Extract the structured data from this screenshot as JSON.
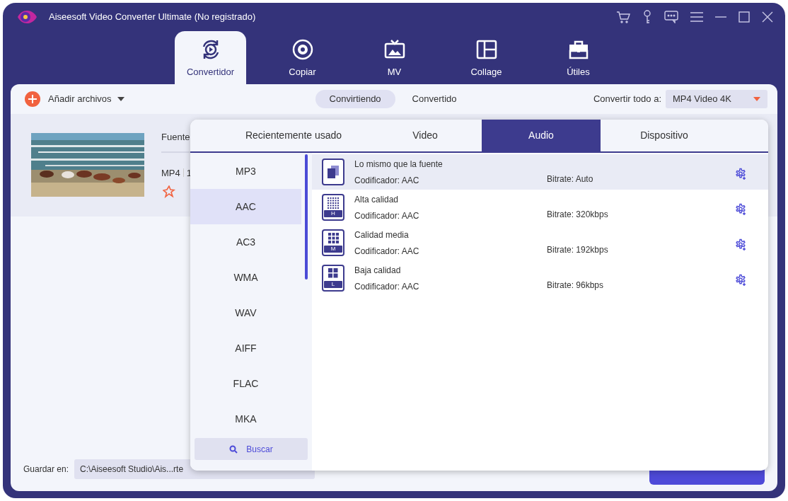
{
  "window": {
    "title": "Aiseesoft Video Converter Ultimate (No registrado)"
  },
  "nav_tabs": [
    {
      "label": "Convertidor",
      "selected": true,
      "kind": "convert"
    },
    {
      "label": "Copiar",
      "selected": false,
      "kind": "disc"
    },
    {
      "label": "MV",
      "selected": false,
      "kind": "tv"
    },
    {
      "label": "Collage",
      "selected": false,
      "kind": "collage"
    },
    {
      "label": "Útiles",
      "selected": false,
      "kind": "toolbox"
    }
  ],
  "toolbar": {
    "add_files": "Añadir archivos",
    "status_tabs": [
      {
        "label": "Convirtiendo",
        "selected": true
      },
      {
        "label": "Convertido",
        "selected": false
      }
    ],
    "convert_all_label": "Convertir todo a:",
    "convert_all_value": "MP4 Video 4K"
  },
  "file": {
    "source_label": "Fuente",
    "format": "MP4",
    "size": "1"
  },
  "popup": {
    "tabs": [
      {
        "label": "Recientemente usado",
        "selected": false
      },
      {
        "label": "Video",
        "selected": false
      },
      {
        "label": "Audio",
        "selected": true
      },
      {
        "label": "Dispositivo",
        "selected": false
      }
    ],
    "formats": [
      {
        "label": "MP3",
        "selected": false
      },
      {
        "label": "AAC",
        "selected": true
      },
      {
        "label": "AC3",
        "selected": false
      },
      {
        "label": "WMA",
        "selected": false
      },
      {
        "label": "WAV",
        "selected": false
      },
      {
        "label": "AIFF",
        "selected": false
      },
      {
        "label": "FLAC",
        "selected": false
      },
      {
        "label": "MKA",
        "selected": false
      }
    ],
    "search": "Buscar",
    "presets": [
      {
        "kind": "source",
        "name": "Lo mismo que la fuente",
        "encoder": "Codificador: AAC",
        "bitrate": "Bitrate: Auto",
        "selected": true
      },
      {
        "kind": "high",
        "badge": "H",
        "name": "Alta calidad",
        "encoder": "Codificador: AAC",
        "bitrate": "Bitrate: 320kbps",
        "selected": false
      },
      {
        "kind": "medium",
        "badge": "M",
        "name": "Calidad media",
        "encoder": "Codificador: AAC",
        "bitrate": "Bitrate: 192kbps",
        "selected": false
      },
      {
        "kind": "low",
        "badge": "L",
        "name": "Baja calidad",
        "encoder": "Codificador: AAC",
        "bitrate": "Bitrate: 96kbps",
        "selected": false
      }
    ]
  },
  "footer": {
    "save_label": "Guardar en:",
    "path": "C:\\Aiseesoft Studio\\Ais...rte"
  }
}
